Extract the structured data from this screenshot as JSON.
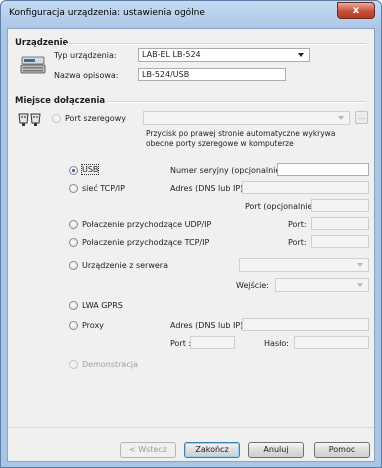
{
  "window": {
    "title": "Konfiguracja urządzenia: ustawienia ogólne",
    "close_glyph": "x"
  },
  "device": {
    "section": "Urządzenie",
    "type_label": "Typ urządzenia:",
    "type_value": "LAB-EL LB-524",
    "name_label": "Nazwa opisowa:",
    "name_value": "LB-524/USB"
  },
  "connection": {
    "section": "Miejsce dołączenia",
    "serial_label": "Port szeregowy",
    "serial_browse": "...",
    "serial_hint_line1": "Przycisk po prawej stronie automatyczne wykrywa",
    "serial_hint_line2": "obecne porty szeregowe w komputerze",
    "usb_label": "USB",
    "serial_number_label": "Numer seryjny (opcjonalnie):",
    "tcp_label": "sieć TCP/IP",
    "dns_label": "Adres (DNS lub IP):",
    "port_opt_label": "Port (opcjonalnie):",
    "udp_label": "Połaczenie przychodzące UDP/IP",
    "udp_port_label": "Port:",
    "tcpin_label": "Połaczenie przychodzące TCP/IP",
    "tcpin_port_label": "Port:",
    "server_label": "Urządzenie z serwera",
    "input_label": "Wejście:",
    "gprs_label": "LWA GPRS",
    "proxy_label": "Proxy",
    "proxy_dns_label": "Adres (DNS lub IP):",
    "proxy_port_label": "Port :",
    "proxy_password_label": "Hasło:",
    "demo_label": "Demonstracja",
    "selected": "USB"
  },
  "buttons": {
    "back": "< Wstecz",
    "finish": "Zakończ",
    "cancel": "Anuluj",
    "help": "Pomoc"
  },
  "icons": {
    "device": "device-icon",
    "connection": "serial-ports-icon"
  },
  "colors": {
    "title_bar": "#a9c5e6",
    "close": "#c7503b",
    "radio_selected": "#1d5fbf"
  }
}
